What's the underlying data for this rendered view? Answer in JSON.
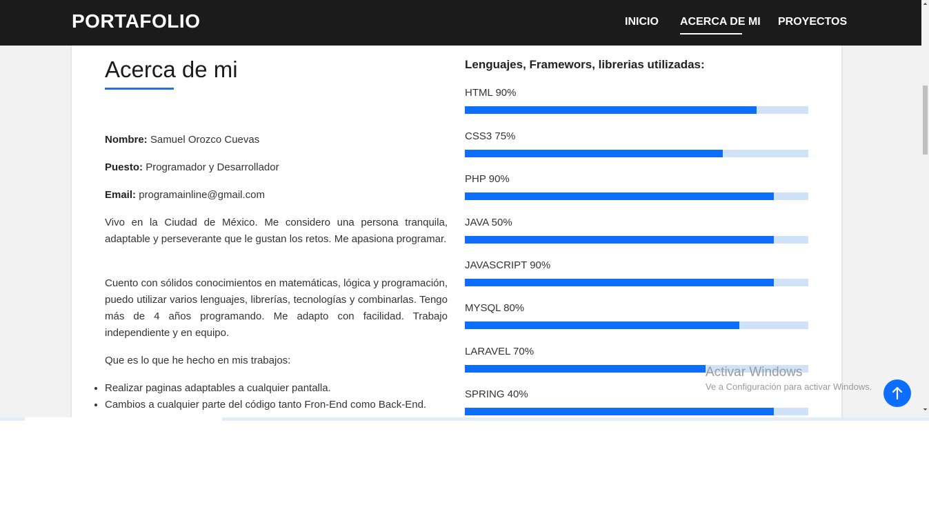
{
  "navbar": {
    "brand": "PORTAFOLIO",
    "links": [
      "INICIO",
      "ACERCA DE MI",
      "PROYECTOS"
    ],
    "active": "ACERCA DE MI"
  },
  "about": {
    "title": "Acerca de mi",
    "name_label": "Nombre:",
    "name_value": "Samuel Orozco Cuevas",
    "position_label": "Puesto:",
    "position_value": "Programador y Desarrollador",
    "email_label": "Email:",
    "email_value": "programainline@gmail.com",
    "paragraphs": [
      "Vivo en la Ciudad de México. Me considero una persona tranquila, adaptable y perseverante que le gustan los retos. Me apasiona programar.",
      "Cuento con sólidos conocimientos en matemáticas, lógica y programación, puedo utilizar varios lenguajes, librerías, tecnologías y combinarlas. Tengo más de 4 años programando. Me adapto con facilidad. Trabajo independiente y en equipo.",
      "Que es lo que he hecho en mis trabajos:"
    ],
    "bullets": [
      "Realizar paginas adaptables a cualquier pantalla.",
      "Cambios a cualquier parte del código tanto Fron-End como Back-End."
    ]
  },
  "skills": {
    "heading": "Lenguajes, Framewors, librerias utilizadas:",
    "items": [
      {
        "label": "HTML 90%",
        "fill": 0.85
      },
      {
        "label": "CSS3 75%",
        "fill": 0.75
      },
      {
        "label": "PHP 90%",
        "fill": 0.9
      },
      {
        "label": "JAVA 50%",
        "fill": 0.9
      },
      {
        "label": "JAVASCRIPT 90%",
        "fill": 0.9
      },
      {
        "label": "MYSQL 80%",
        "fill": 0.8
      },
      {
        "label": "LARAVEL 70%",
        "fill": 0.7
      },
      {
        "label": "SPRING 40%",
        "fill": 0.9
      }
    ],
    "track_color": "#cfe2f7",
    "fill_color": "#0d6efd"
  },
  "overlay": {
    "watermark_title": "Activar Windows",
    "watermark_subtitle": "Ve a Configuración para activar Windows.",
    "scroll_top_icon": "arrow-up-icon"
  }
}
